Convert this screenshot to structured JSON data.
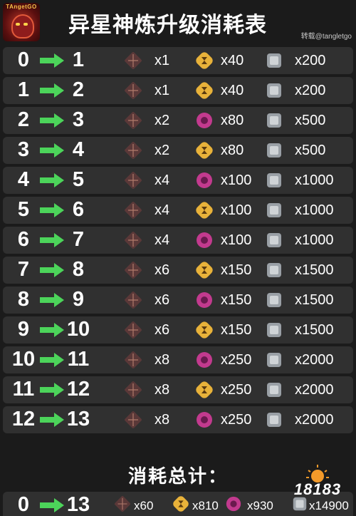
{
  "header": {
    "logo_text": "TAngetGO",
    "title": "异星神炼升级消耗表",
    "credit": "转载@tangletgo"
  },
  "rows": [
    {
      "from": "0",
      "to": "1",
      "a": "x1",
      "b": "x40",
      "c": "x200",
      "b_type": "gold"
    },
    {
      "from": "1",
      "to": "2",
      "a": "x1",
      "b": "x40",
      "c": "x200",
      "b_type": "gold"
    },
    {
      "from": "2",
      "to": "3",
      "a": "x2",
      "b": "x80",
      "c": "x500",
      "b_type": "pink"
    },
    {
      "from": "3",
      "to": "4",
      "a": "x2",
      "b": "x80",
      "c": "x500",
      "b_type": "gold"
    },
    {
      "from": "4",
      "to": "5",
      "a": "x4",
      "b": "x100",
      "c": "x1000",
      "b_type": "pink"
    },
    {
      "from": "5",
      "to": "6",
      "a": "x4",
      "b": "x100",
      "c": "x1000",
      "b_type": "gold"
    },
    {
      "from": "6",
      "to": "7",
      "a": "x4",
      "b": "x100",
      "c": "x1000",
      "b_type": "pink"
    },
    {
      "from": "7",
      "to": "8",
      "a": "x6",
      "b": "x150",
      "c": "x1500",
      "b_type": "gold"
    },
    {
      "from": "8",
      "to": "9",
      "a": "x6",
      "b": "x150",
      "c": "x1500",
      "b_type": "pink"
    },
    {
      "from": "9",
      "to": "10",
      "a": "x6",
      "b": "x150",
      "c": "x1500",
      "b_type": "gold"
    },
    {
      "from": "10",
      "to": "11",
      "a": "x8",
      "b": "x250",
      "c": "x2000",
      "b_type": "pink"
    },
    {
      "from": "11",
      "to": "12",
      "a": "x8",
      "b": "x250",
      "c": "x2000",
      "b_type": "gold"
    },
    {
      "from": "12",
      "to": "13",
      "a": "x8",
      "b": "x250",
      "c": "x2000",
      "b_type": "pink"
    }
  ],
  "total": {
    "label": "消耗总计：",
    "from": "0",
    "to": "13",
    "a": "x60",
    "b": "x810",
    "c": "x930",
    "d": "x14900"
  },
  "watermark": {
    "text": "18183"
  },
  "colors": {
    "arrow": "#4cd45a",
    "row_bg": "#303030",
    "page_bg": "#1b1b1b",
    "gold_item": "#e8b23a",
    "pink_item": "#c23a8e",
    "cube": "#9aa0a6",
    "shard": "#7a4a4a"
  },
  "icons": {
    "a": "dark-crystal-shard-icon",
    "b_gold": "gold-hourglass-icon",
    "b_pink": "pink-orb-icon",
    "c": "silver-cube-icon",
    "arrow": "green-arrow-icon"
  }
}
